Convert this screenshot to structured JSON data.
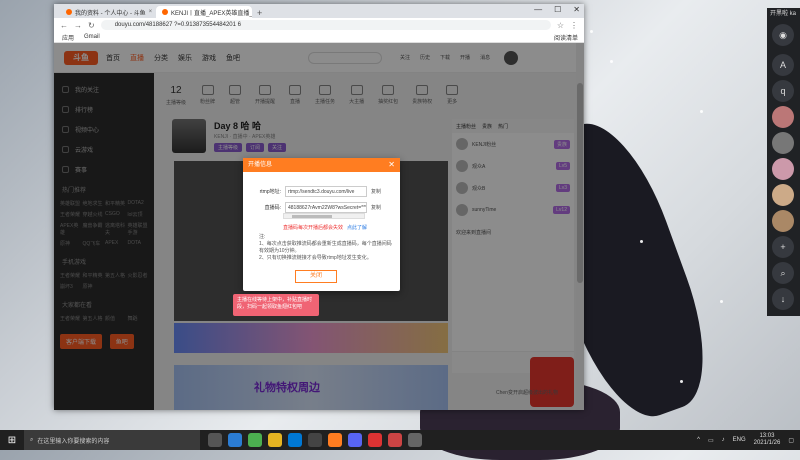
{
  "browser": {
    "tabs": [
      {
        "label": "我的资料 - 个人中心 - 斗鱼",
        "active": false
      },
      {
        "label": "KENJI丨直播_APEX英雄直播_斗...",
        "active": true
      }
    ],
    "new_tab": "+",
    "url": "douyu.com/48188627 ?=0.913873554484201 6",
    "bookmarks": [
      "应用",
      "Gmail"
    ],
    "reading_list": "阅读清单",
    "window_controls": [
      "—",
      "☐",
      "✕"
    ]
  },
  "douyu": {
    "logo": "斗鱼",
    "nav": [
      "首页",
      "直播",
      "分类",
      "娱乐",
      "游戏",
      "鱼吧"
    ],
    "header_icons": [
      "关注",
      "历史",
      "下载",
      "开播",
      "消息"
    ],
    "sidebar": {
      "items": [
        "我的关注",
        "排行榜",
        "视频中心",
        "云游戏",
        "赛事"
      ],
      "popular_head": "热门推荐",
      "popular": [
        "英雄联盟",
        "绝地求生",
        "和平精英",
        "DOTA2",
        "王者荣耀",
        "穿越火线",
        "CSGO",
        "lol云顶",
        "APEX英雄",
        "魔兽争霸",
        "逃离塔科夫",
        "英雄联盟手游",
        "原神",
        "QQ飞车",
        "APEX",
        "DOTA"
      ],
      "mobile_head": "手机游戏",
      "mobile": [
        "王者荣耀",
        "和平精英",
        "第五人格",
        "火影忍者",
        "崩坏3",
        "原神"
      ],
      "ent_head": "大家都在看",
      "ent": [
        "王者荣耀",
        "第五人格",
        "颜值",
        "舞蹈"
      ],
      "buttons": [
        "客户端下载",
        "鱼吧"
      ]
    },
    "categories": [
      "主播等级",
      "粉丝牌",
      "超管",
      "开播提醒",
      "直播",
      "主播任务",
      "大主播",
      "抽奖红包",
      "贵族特权",
      "更多"
    ],
    "rank_number": "12",
    "room": {
      "title": "Day 8 哈 哈",
      "subtitle": "KENJI · 直播中 · APEX英雄",
      "tags": [
        "主播等级",
        "订阅",
        "关注"
      ]
    },
    "chat": {
      "tabs": [
        "主播粉丝",
        "贵族",
        "热门"
      ],
      "rows": [
        {
          "name": "KENJI粉丝",
          "badge": "贵族"
        },
        {
          "name": "观众A",
          "badge": "Lv5"
        },
        {
          "name": "观众B",
          "badge": "Lv3"
        },
        {
          "name": "sunnyTime",
          "badge": "Lv12"
        }
      ],
      "welcome": "欢迎来到直播间"
    },
    "banner": "礼物特权周边",
    "wechat_text": "Chen变开启超级波出的礼物"
  },
  "dialog": {
    "title": "开播信息",
    "close": "✕",
    "rtmp_label": "rtmp地址:",
    "rtmp_value": "rtmp://sendtc3.douyu.com/live",
    "key_label": "直播码:",
    "key_value": "48188627rAvm22W8?wsSecret=******",
    "copy": "复制",
    "warning": "直播码每次开播后都会失效",
    "learn_more": "点此了解",
    "note_title": "注:",
    "notes": [
      "1、每次点击获取推流码都会重新生成直播码，每个直播间码有效期为10分钟。",
      "2、只有切换推流链接才会导致rtmp地址发生变化。"
    ],
    "button": "关闭"
  },
  "red_tooltip": "主播在线等待上架中，补贴直播时段，扫码一起领取鱼翅红包吧",
  "discord": {
    "header": "开黑啦 ka",
    "icons": [
      "A",
      "q"
    ]
  },
  "taskbar": {
    "search_placeholder": "在这里输入你要搜索的内容",
    "lang": "ENG",
    "time": "13:03",
    "date": "2021/1/26"
  },
  "colors": {
    "douyu_orange": "#ff5d23",
    "dialog_orange": "#ff7d21",
    "discord_bg": "#202225",
    "taskbar_bg": "#202020"
  }
}
